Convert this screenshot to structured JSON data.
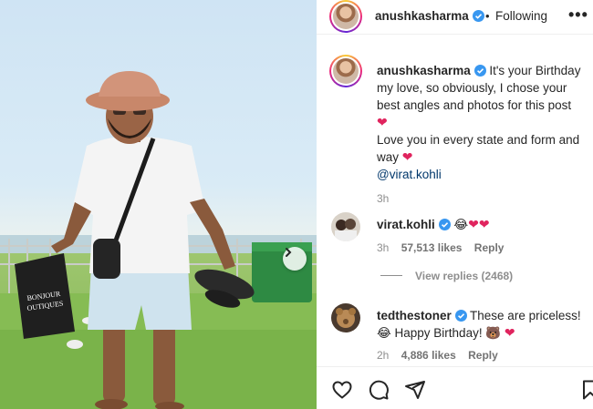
{
  "photo": {
    "bag_text": "BONJOUR OUTIQUES"
  },
  "header": {
    "username": "anushkasharma",
    "separator": "•",
    "follow_state": "Following",
    "more_label": "•••"
  },
  "caption": {
    "username": "anushkasharma",
    "line1": " It's your Birthday my love, so obviously, I chose your best angles and photos for this post",
    "line2": "Love you in every state and form and way",
    "mention": "@virat.kohli",
    "time": "3h"
  },
  "comments": [
    {
      "username": "virat.kohli",
      "emoji": "😂",
      "time": "3h",
      "likes": "57,513 likes",
      "reply": "Reply"
    },
    {
      "username": "tedthestoner",
      "text": " These are priceless!",
      "text2": "😂 Happy Birthday! 🐻",
      "time": "2h",
      "likes": "4,886 likes",
      "reply": "Reply"
    }
  ],
  "view_replies": "View replies (2468)",
  "colors": {
    "verified": "#3897f0",
    "heart": "#e0245e",
    "link": "#00376b",
    "muted": "#8e8e8e"
  },
  "icons": [
    "like-icon",
    "comment-icon",
    "share-icon",
    "save-icon",
    "verified-icon",
    "chevron-right-icon",
    "more-icon"
  ]
}
